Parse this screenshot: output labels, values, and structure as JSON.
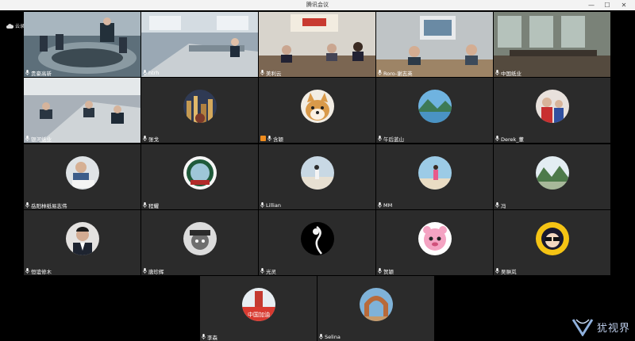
{
  "window": {
    "title": "腾讯会议",
    "minimize": "—",
    "maximize": "☐",
    "close": "✕"
  },
  "status": {
    "cloud_text": "云录制中"
  },
  "participants": [
    {
      "name": "贵豪高新",
      "type": "video",
      "scene": "meeting-room"
    },
    {
      "name": "htrh",
      "type": "video",
      "scene": "office-desks"
    },
    {
      "name": "美利云",
      "type": "video",
      "scene": "conference-table"
    },
    {
      "name": "Roro-谢志英",
      "type": "video",
      "scene": "small-meeting"
    },
    {
      "name": "中国纸业",
      "type": "video",
      "scene": "empty-room"
    },
    {
      "name": "银河纸业",
      "type": "video",
      "scene": "office-staff"
    },
    {
      "name": "张戈",
      "type": "avatar",
      "avatar": "city-night"
    },
    {
      "name": "含颖",
      "type": "avatar",
      "avatar": "shiba-dog",
      "host": true
    },
    {
      "name": "午后蓝山",
      "type": "avatar",
      "avatar": "lake-mountain"
    },
    {
      "name": "Derek_董",
      "type": "avatar",
      "avatar": "family-photo"
    },
    {
      "name": "岳阳林纸易志伟",
      "type": "avatar",
      "avatar": "child-reading"
    },
    {
      "name": "程耀",
      "type": "avatar",
      "avatar": "emblem-badge"
    },
    {
      "name": "Lillian",
      "type": "avatar",
      "avatar": "beach-walk"
    },
    {
      "name": "MM",
      "type": "avatar",
      "avatar": "beach-girl"
    },
    {
      "name": "冯",
      "type": "avatar",
      "avatar": "forest-landscape"
    },
    {
      "name": "恒谊修木",
      "type": "avatar",
      "avatar": "man-portrait"
    },
    {
      "name": "唐珍辉",
      "type": "avatar",
      "avatar": "cartoon-hat"
    },
    {
      "name": "光灵",
      "type": "avatar",
      "avatar": "sketch-figure"
    },
    {
      "name": "贺颖",
      "type": "avatar",
      "avatar": "pink-mascot"
    },
    {
      "name": "吴翀岚",
      "type": "avatar",
      "avatar": "cartoon-glasses"
    },
    {
      "name": "李森",
      "type": "avatar",
      "avatar": "china-cheer",
      "avatar_text": "中国加油"
    },
    {
      "name": "Selina",
      "type": "avatar",
      "avatar": "stone-arch"
    }
  ],
  "watermark": {
    "text": "犹视界"
  }
}
